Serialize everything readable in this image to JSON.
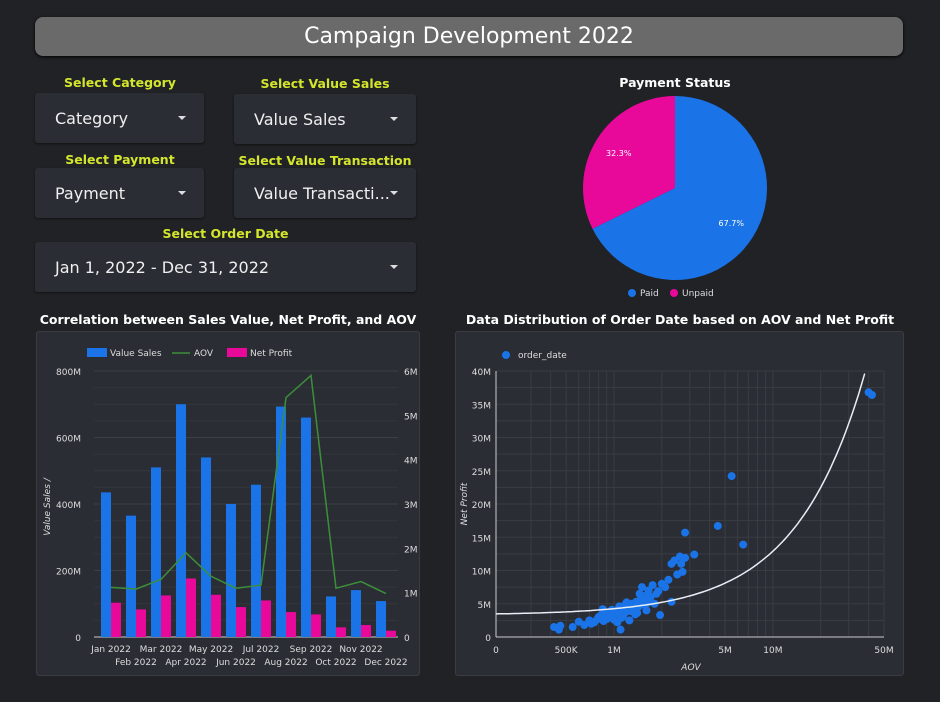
{
  "header": {
    "title": "Campaign Development 2022"
  },
  "filters": {
    "category": {
      "label": "Select Category",
      "value": "Category"
    },
    "value_sales": {
      "label": "Select Value Sales",
      "value": "Value Sales"
    },
    "payment": {
      "label": "Select Payment",
      "value": "Payment"
    },
    "value_transaction": {
      "label": "Select Value Transaction",
      "value": "Value Transacti..."
    },
    "order_date": {
      "label": "Select Order Date",
      "value": "Jan 1, 2022 - Dec 31, 2022"
    }
  },
  "chart_data": [
    {
      "type": "pie",
      "title": "Payment Status",
      "slices": [
        {
          "name": "Paid",
          "value": 67.7,
          "label": "67.7%",
          "color": "#1a74e8"
        },
        {
          "name": "Unpaid",
          "value": 32.3,
          "label": "32.3%",
          "color": "#e8099a"
        }
      ],
      "legend": "bottom"
    },
    {
      "type": "bar",
      "title": "Correlation between Sales Value, Net Profit, and AOV",
      "categories": [
        "Jan 2022",
        "Feb 2022",
        "Mar 2022",
        "Apr 2022",
        "May 2022",
        "Jun 2022",
        "Jul 2022",
        "Aug 2022",
        "Sep 2022",
        "Oct 2022",
        "Nov 2022",
        "Dec 2022"
      ],
      "series": [
        {
          "name": "Value Sales",
          "type": "bar",
          "axis": "left",
          "color": "#1a74e8",
          "values": [
            435,
            365,
            510,
            700,
            540,
            400,
            458,
            693,
            660,
            122,
            141,
            108
          ]
        },
        {
          "name": "AOV",
          "type": "line",
          "axis": "right",
          "color": "#3c8f3a",
          "values": [
            1.12,
            1.08,
            1.3,
            1.9,
            1.37,
            1.1,
            1.17,
            5.4,
            5.9,
            1.1,
            1.25,
            0.98
          ]
        },
        {
          "name": "Net Profit",
          "type": "bar",
          "axis": "left",
          "color": "#e8099a",
          "values": [
            103,
            83,
            125,
            176,
            127,
            90,
            110,
            75,
            68,
            29,
            36,
            19
          ]
        }
      ],
      "ylabel": "Value Sales /",
      "ylim": [
        0,
        800
      ],
      "yticks": [
        "0",
        "200M",
        "400M",
        "600M",
        "800M"
      ],
      "y2lim": [
        0,
        6
      ],
      "y2ticks": [
        "0",
        "1M",
        "2M",
        "3M",
        "4M",
        "5M",
        "6M"
      ],
      "legend": "top-left"
    },
    {
      "type": "scatter",
      "title": "Data Distribution of Order Date based on AOV and Net Profit",
      "series_name": "order_date",
      "color": "#1a74e8",
      "xlabel": "AOV",
      "ylabel": "Net Profit",
      "xscale": "log",
      "xlim_millions": [
        0.181,
        50
      ],
      "ylim_millions": [
        0,
        40
      ],
      "xticks": [
        {
          "v": 0.181,
          "t": "0"
        },
        {
          "v": 0.5,
          "t": "500K"
        },
        {
          "v": 1,
          "t": "1M"
        },
        {
          "v": 5,
          "t": "5M"
        },
        {
          "v": 10,
          "t": "10M"
        },
        {
          "v": 50,
          "t": "50M"
        }
      ],
      "yticks": [
        "0",
        "5M",
        "10M",
        "15M",
        "20M",
        "25M",
        "30M",
        "35M",
        "40M"
      ],
      "trendline": {
        "type": "linear",
        "intercept_millions": 3.3,
        "slope": 0.96
      },
      "points_millions": [
        [
          0.42,
          1.5
        ],
        [
          0.45,
          1.1
        ],
        [
          0.46,
          1.7
        ],
        [
          0.55,
          1.5
        ],
        [
          0.6,
          2.3
        ],
        [
          0.65,
          1.8
        ],
        [
          0.7,
          2.5
        ],
        [
          0.75,
          2.2
        ],
        [
          0.8,
          3.0
        ],
        [
          0.85,
          4.2
        ],
        [
          0.9,
          2.7
        ],
        [
          0.95,
          3.5
        ],
        [
          1.0,
          3.0
        ],
        [
          1.05,
          4.0
        ],
        [
          1.1,
          3.5
        ],
        [
          1.1,
          1.1
        ],
        [
          1.15,
          4.5
        ],
        [
          1.2,
          3.8
        ],
        [
          1.25,
          2.5
        ],
        [
          1.3,
          5.0
        ],
        [
          1.35,
          4.2
        ],
        [
          1.4,
          3.6
        ],
        [
          1.45,
          6.5
        ],
        [
          1.5,
          7.5
        ],
        [
          1.55,
          5.5
        ],
        [
          1.6,
          4.0
        ],
        [
          1.65,
          7.0
        ],
        [
          1.7,
          6.0
        ],
        [
          1.75,
          7.8
        ],
        [
          1.8,
          5.0
        ],
        [
          1.85,
          6.5
        ],
        [
          1.95,
          3.3
        ],
        [
          2.0,
          8.0
        ],
        [
          2.1,
          7.5
        ],
        [
          2.2,
          8.6
        ],
        [
          2.3,
          5.3
        ],
        [
          2.3,
          11.0
        ],
        [
          2.4,
          11.5
        ],
        [
          2.5,
          9.4
        ],
        [
          2.6,
          12.1
        ],
        [
          2.65,
          11.0
        ],
        [
          2.7,
          9.8
        ],
        [
          2.8,
          11.9
        ],
        [
          2.8,
          15.7
        ],
        [
          3.2,
          12.4
        ],
        [
          4.5,
          16.7
        ],
        [
          5.5,
          24.2
        ],
        [
          6.5,
          13.9
        ],
        [
          40,
          36.8
        ],
        [
          42,
          36.4
        ],
        [
          0.88,
          3.8
        ],
        [
          0.92,
          3.2
        ],
        [
          0.97,
          4.1
        ],
        [
          1.02,
          3.6
        ],
        [
          1.08,
          4.6
        ],
        [
          1.12,
          2.9
        ],
        [
          1.18,
          4.9
        ],
        [
          1.22,
          4.4
        ],
        [
          1.28,
          3.9
        ],
        [
          1.32,
          4.7
        ],
        [
          1.38,
          5.3
        ],
        [
          1.42,
          4.5
        ],
        [
          1.48,
          5.8
        ],
        [
          1.52,
          4.9
        ],
        [
          1.58,
          6.2
        ],
        [
          1.62,
          5.1
        ],
        [
          0.78,
          2.6
        ],
        [
          0.83,
          3.3
        ],
        [
          1.0,
          2.6
        ],
        [
          1.05,
          2.2
        ],
        [
          0.72,
          2.0
        ],
        [
          0.86,
          2.4
        ],
        [
          0.98,
          3.9
        ],
        [
          1.14,
          3.2
        ],
        [
          1.26,
          4.1
        ],
        [
          1.36,
          3.4
        ],
        [
          1.46,
          4.8
        ],
        [
          1.66,
          5.6
        ],
        [
          1.9,
          6.9
        ],
        [
          1.2,
          5.2
        ]
      ]
    }
  ]
}
